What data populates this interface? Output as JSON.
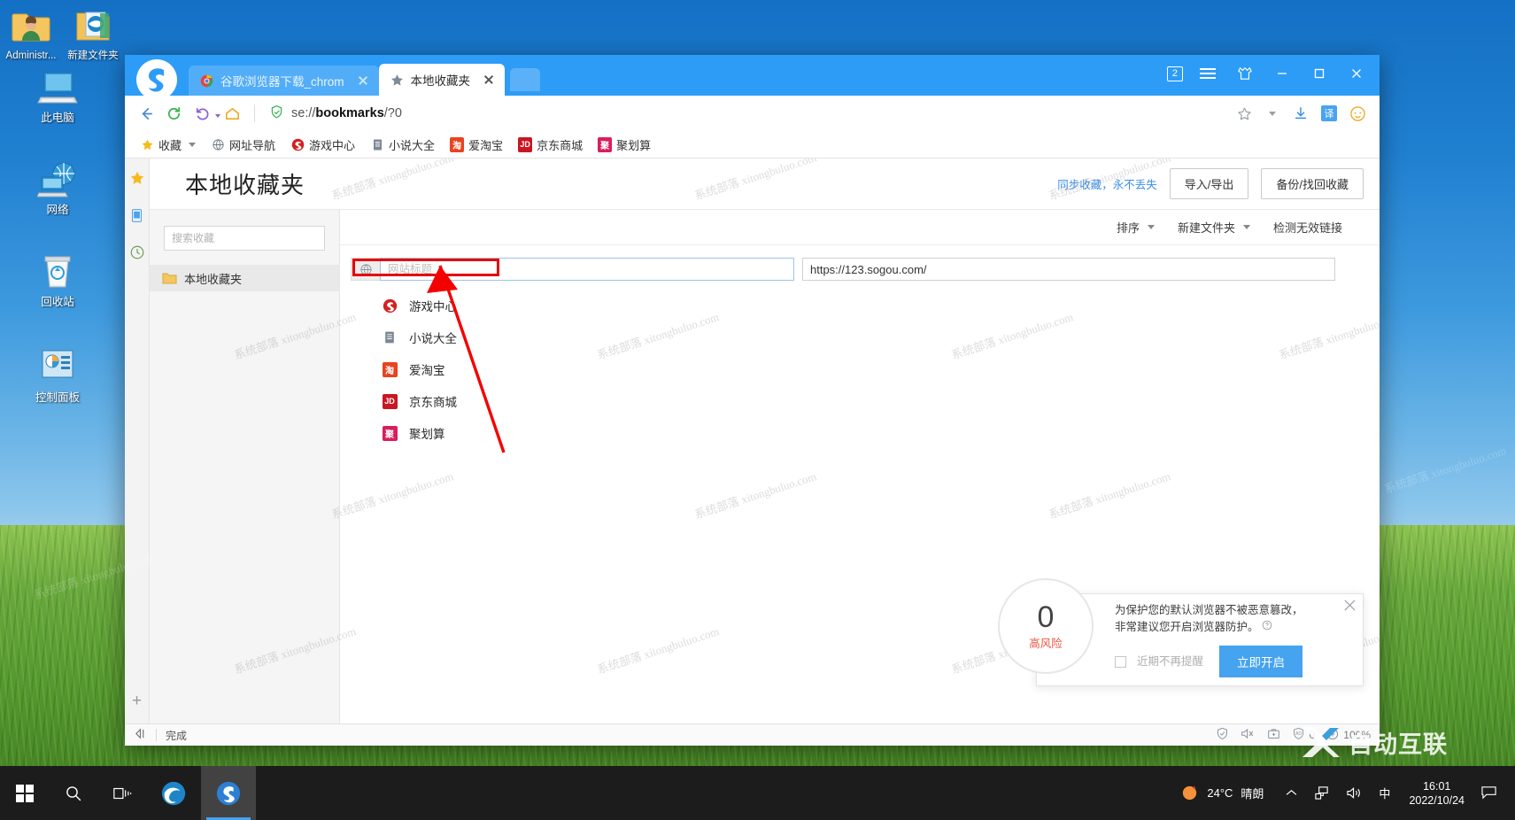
{
  "desktop": {
    "icons": [
      {
        "name": "administrator-folder",
        "label": "Administr..."
      },
      {
        "name": "new-folder",
        "label": "新建文件夹"
      },
      {
        "name": "this-pc",
        "label": "此电脑"
      },
      {
        "name": "network",
        "label": "网络"
      },
      {
        "name": "recycle-bin",
        "label": "回收站"
      },
      {
        "name": "control-panel",
        "label": "控制面板"
      }
    ]
  },
  "browser": {
    "tabs": [
      {
        "title": "谷歌浏览器下载_chrom",
        "active": false
      },
      {
        "title": "本地收藏夹",
        "active": true
      }
    ],
    "tab_count_badge": "2",
    "address": {
      "prefix": "se://",
      "bold": "bookmarks",
      "suffix": "/?0",
      "full": "se://bookmarks/?0"
    },
    "bookmarks_bar": [
      {
        "label": "收藏",
        "icon": "star-icon",
        "has_caret": true
      },
      {
        "label": "网址导航",
        "icon": "globe-icon",
        "has_caret": false
      },
      {
        "label": "游戏中心",
        "icon": "sogou-s-icon",
        "has_caret": false
      },
      {
        "label": "小说大全",
        "icon": "book-icon",
        "has_caret": false
      },
      {
        "label": "爱淘宝",
        "icon": "taobao-icon",
        "has_caret": false
      },
      {
        "label": "京东商城",
        "icon": "jd-icon",
        "has_caret": false
      },
      {
        "label": "聚划算",
        "icon": "juhuasuan-icon",
        "has_caret": false
      }
    ]
  },
  "bookmark_manager": {
    "page_title": "本地收藏夹",
    "sync_link": "同步收藏，永不丢失",
    "import_export_button": "导入/导出",
    "backup_button": "备份/找回收藏",
    "search_placeholder": "搜索收藏",
    "folder_label": "本地收藏夹",
    "tools": {
      "sort": "排序",
      "new_folder": "新建文件夹",
      "check_links": "检测无效链接"
    },
    "editing_row": {
      "title_value": "",
      "title_placeholder": "网站标题",
      "url_value": "https://123.sogou.com/"
    },
    "items": [
      {
        "label": "游戏中心",
        "icon": "sogou-s-icon"
      },
      {
        "label": "小说大全",
        "icon": "book-icon"
      },
      {
        "label": "爱淘宝",
        "icon": "taobao-icon"
      },
      {
        "label": "京东商城",
        "icon": "jd-icon"
      },
      {
        "label": "聚划算",
        "icon": "juhuasuan-icon"
      }
    ]
  },
  "notification": {
    "score": "0",
    "risk_label": "高风险",
    "message_line1": "为保护您的默认浏览器不被恶意篡改，",
    "message_line2": "非常建议您开启浏览器防护。",
    "checkbox_label": "近期不再提醒",
    "action_button": "立即开启"
  },
  "status_bar": {
    "left_text": "完成",
    "ad_count": "0",
    "zoom": "100%"
  },
  "taskbar": {
    "temperature": "24°C",
    "weather": "晴朗",
    "ime": "中",
    "time": "16:01",
    "date": "2022/10/24"
  },
  "watermark": {
    "text": "系统部落 xitongbuluo.com",
    "brand": "自动互联"
  },
  "colors": {
    "accent_blue": "#2d9cf7",
    "link_blue": "#3a8ee6",
    "annotation_red": "#e60000",
    "risk_red": "#e8543f"
  }
}
